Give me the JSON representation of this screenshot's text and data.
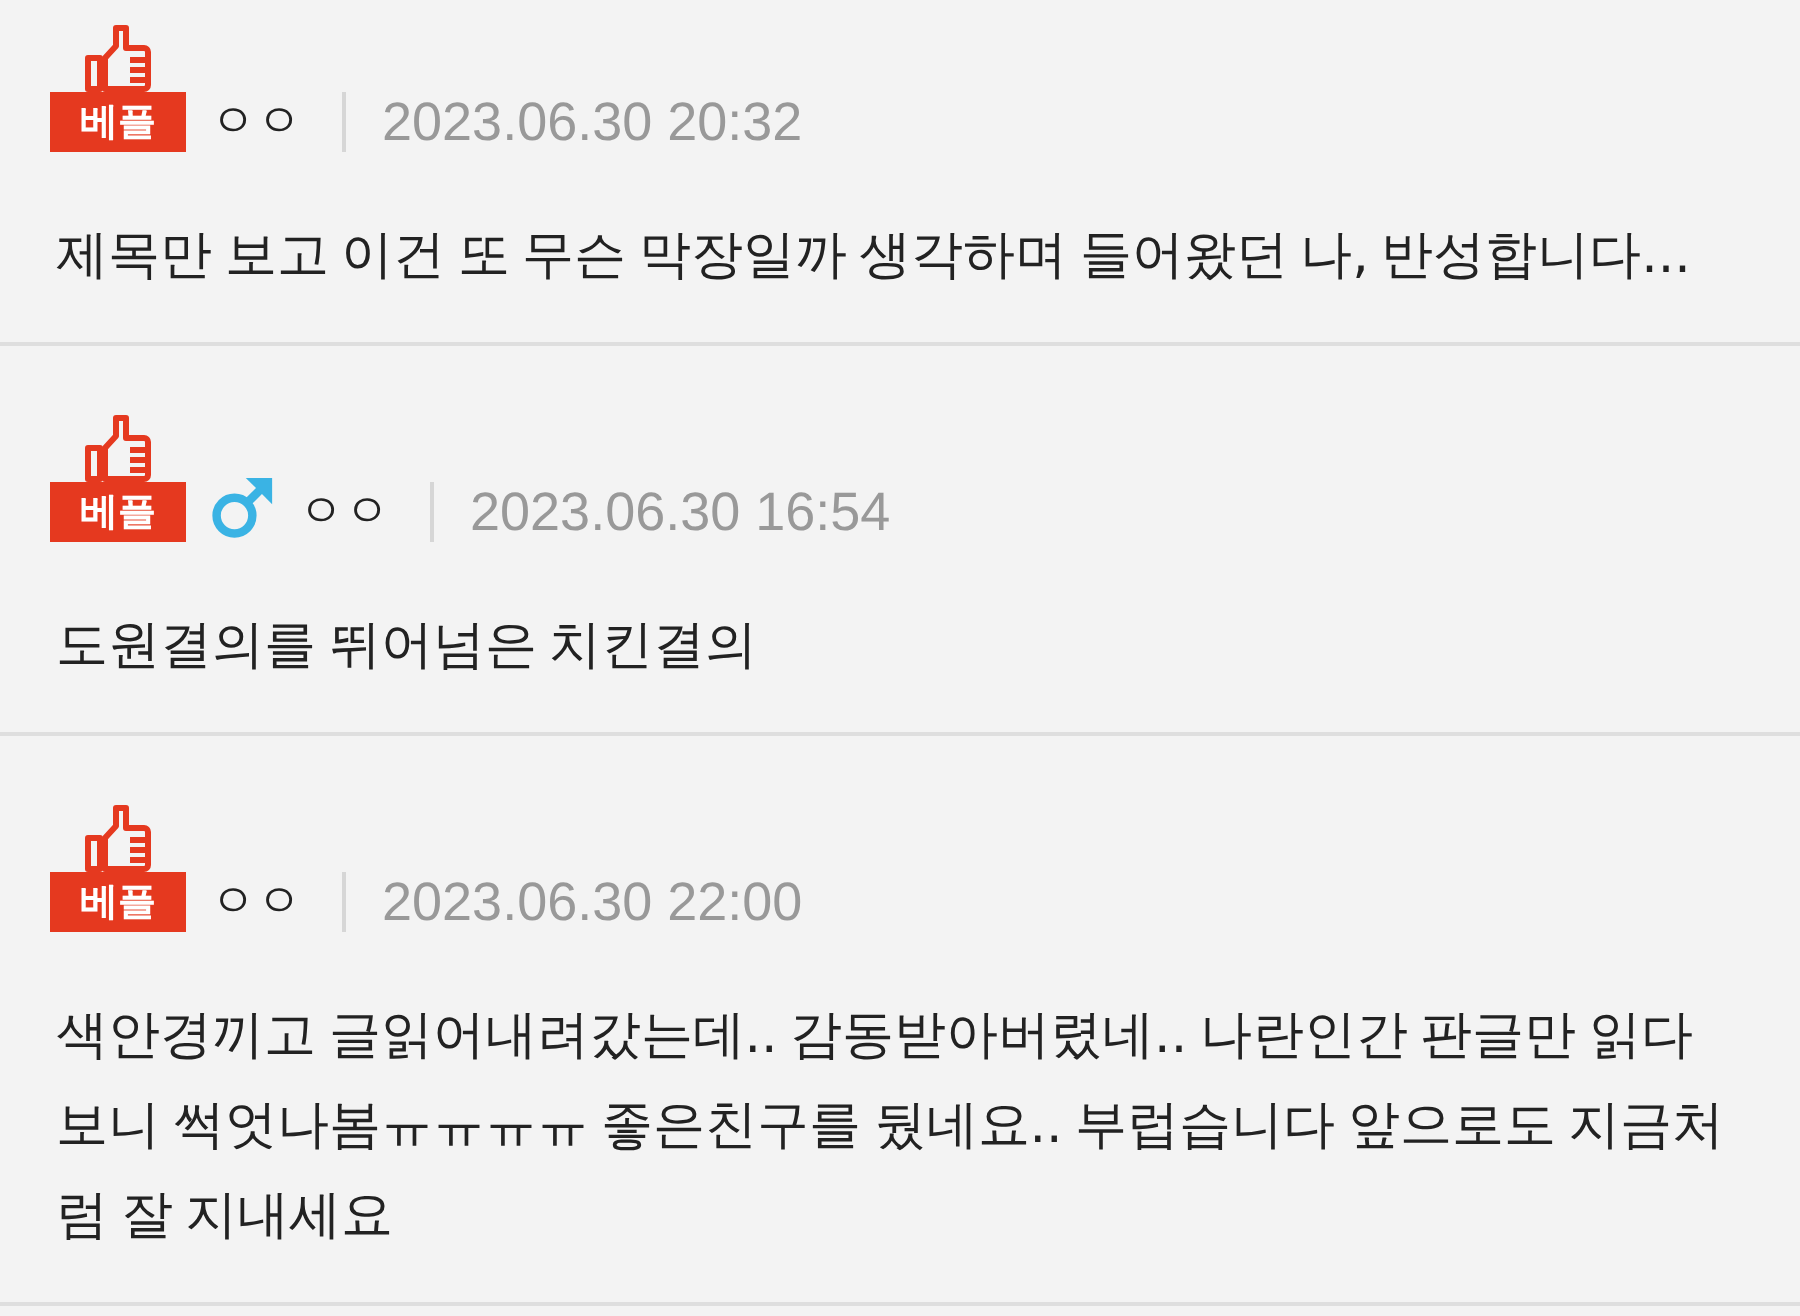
{
  "comments": [
    {
      "badge": "베플",
      "male": false,
      "author": "ㅇㅇ",
      "date": "2023.06.30 20:32",
      "text": "제목만 보고 이건 또 무슨 막장일까 생각하며 들어왔던 나, 반성합니다..."
    },
    {
      "badge": "베플",
      "male": true,
      "author": "ㅇㅇ",
      "date": "2023.06.30 16:54",
      "text": "도원결의를 뛰어넘은 치킨결의"
    },
    {
      "badge": "베플",
      "male": false,
      "author": "ㅇㅇ",
      "date": "2023.06.30 22:00",
      "text": "색안경끼고 글읽어내려갔는데.. 감동받아버렸네.. 나란인간 판글만 읽다보니 썩엇나봄ㅠㅠㅠㅠ 좋은친구를 뒀네요.. 부럽습니다 앞으로도 지금처럼 잘 지내세요"
    }
  ]
}
